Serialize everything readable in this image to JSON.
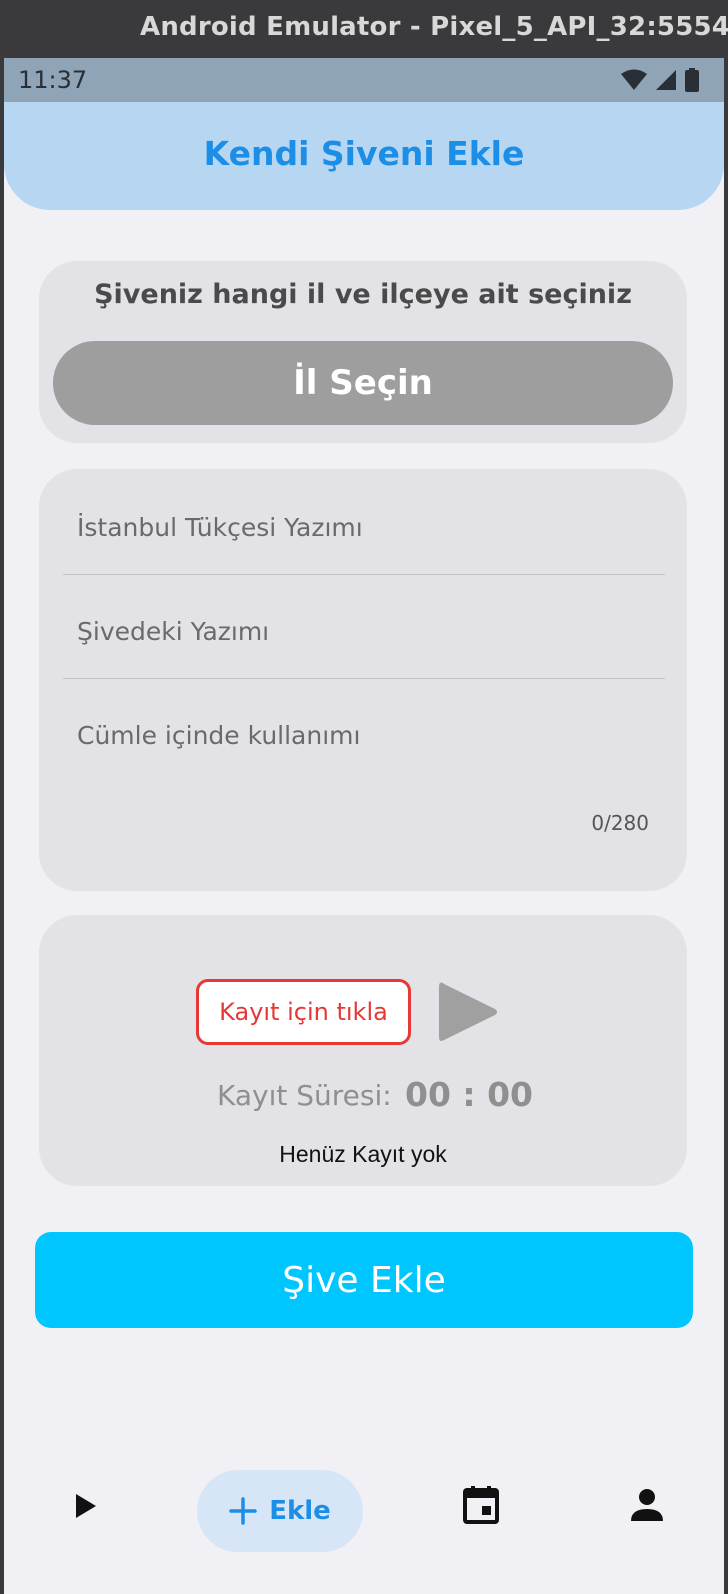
{
  "window": {
    "title": "Android Emulator - Pixel_5_API_32:5554"
  },
  "status_bar": {
    "time": "11:37"
  },
  "header": {
    "title": "Kendi Şiveni Ekle"
  },
  "location_card": {
    "title": "Şiveniz hangi il ve ilçeye ait seçiniz",
    "button_label": "İl Seçin"
  },
  "form": {
    "istanbul_placeholder": "İstanbul Tükçesi Yazımı",
    "dialect_placeholder": "Şivedeki Yazımı",
    "sentence_placeholder": "Cümle içinde kullanımı",
    "counter": "0/280"
  },
  "recording": {
    "record_button": "Kayıt için tıkla",
    "duration_label": "Kayıt Süresi:",
    "duration_value": "00 : 00",
    "status": "Henüz Kayıt yok"
  },
  "submit": {
    "label": "Şive Ekle"
  },
  "bottom_nav": {
    "items": [
      {
        "icon": "play-icon"
      },
      {
        "icon": "plus-icon",
        "label": "Ekle"
      },
      {
        "icon": "calendar-icon"
      },
      {
        "icon": "person-icon"
      }
    ]
  },
  "colors": {
    "accent_blue": "#1c8ee6",
    "header_bg": "#b7d6f2",
    "submit_bg": "#00c6ff",
    "record_red": "#e53935",
    "card_bg": "#e3e3e7"
  }
}
